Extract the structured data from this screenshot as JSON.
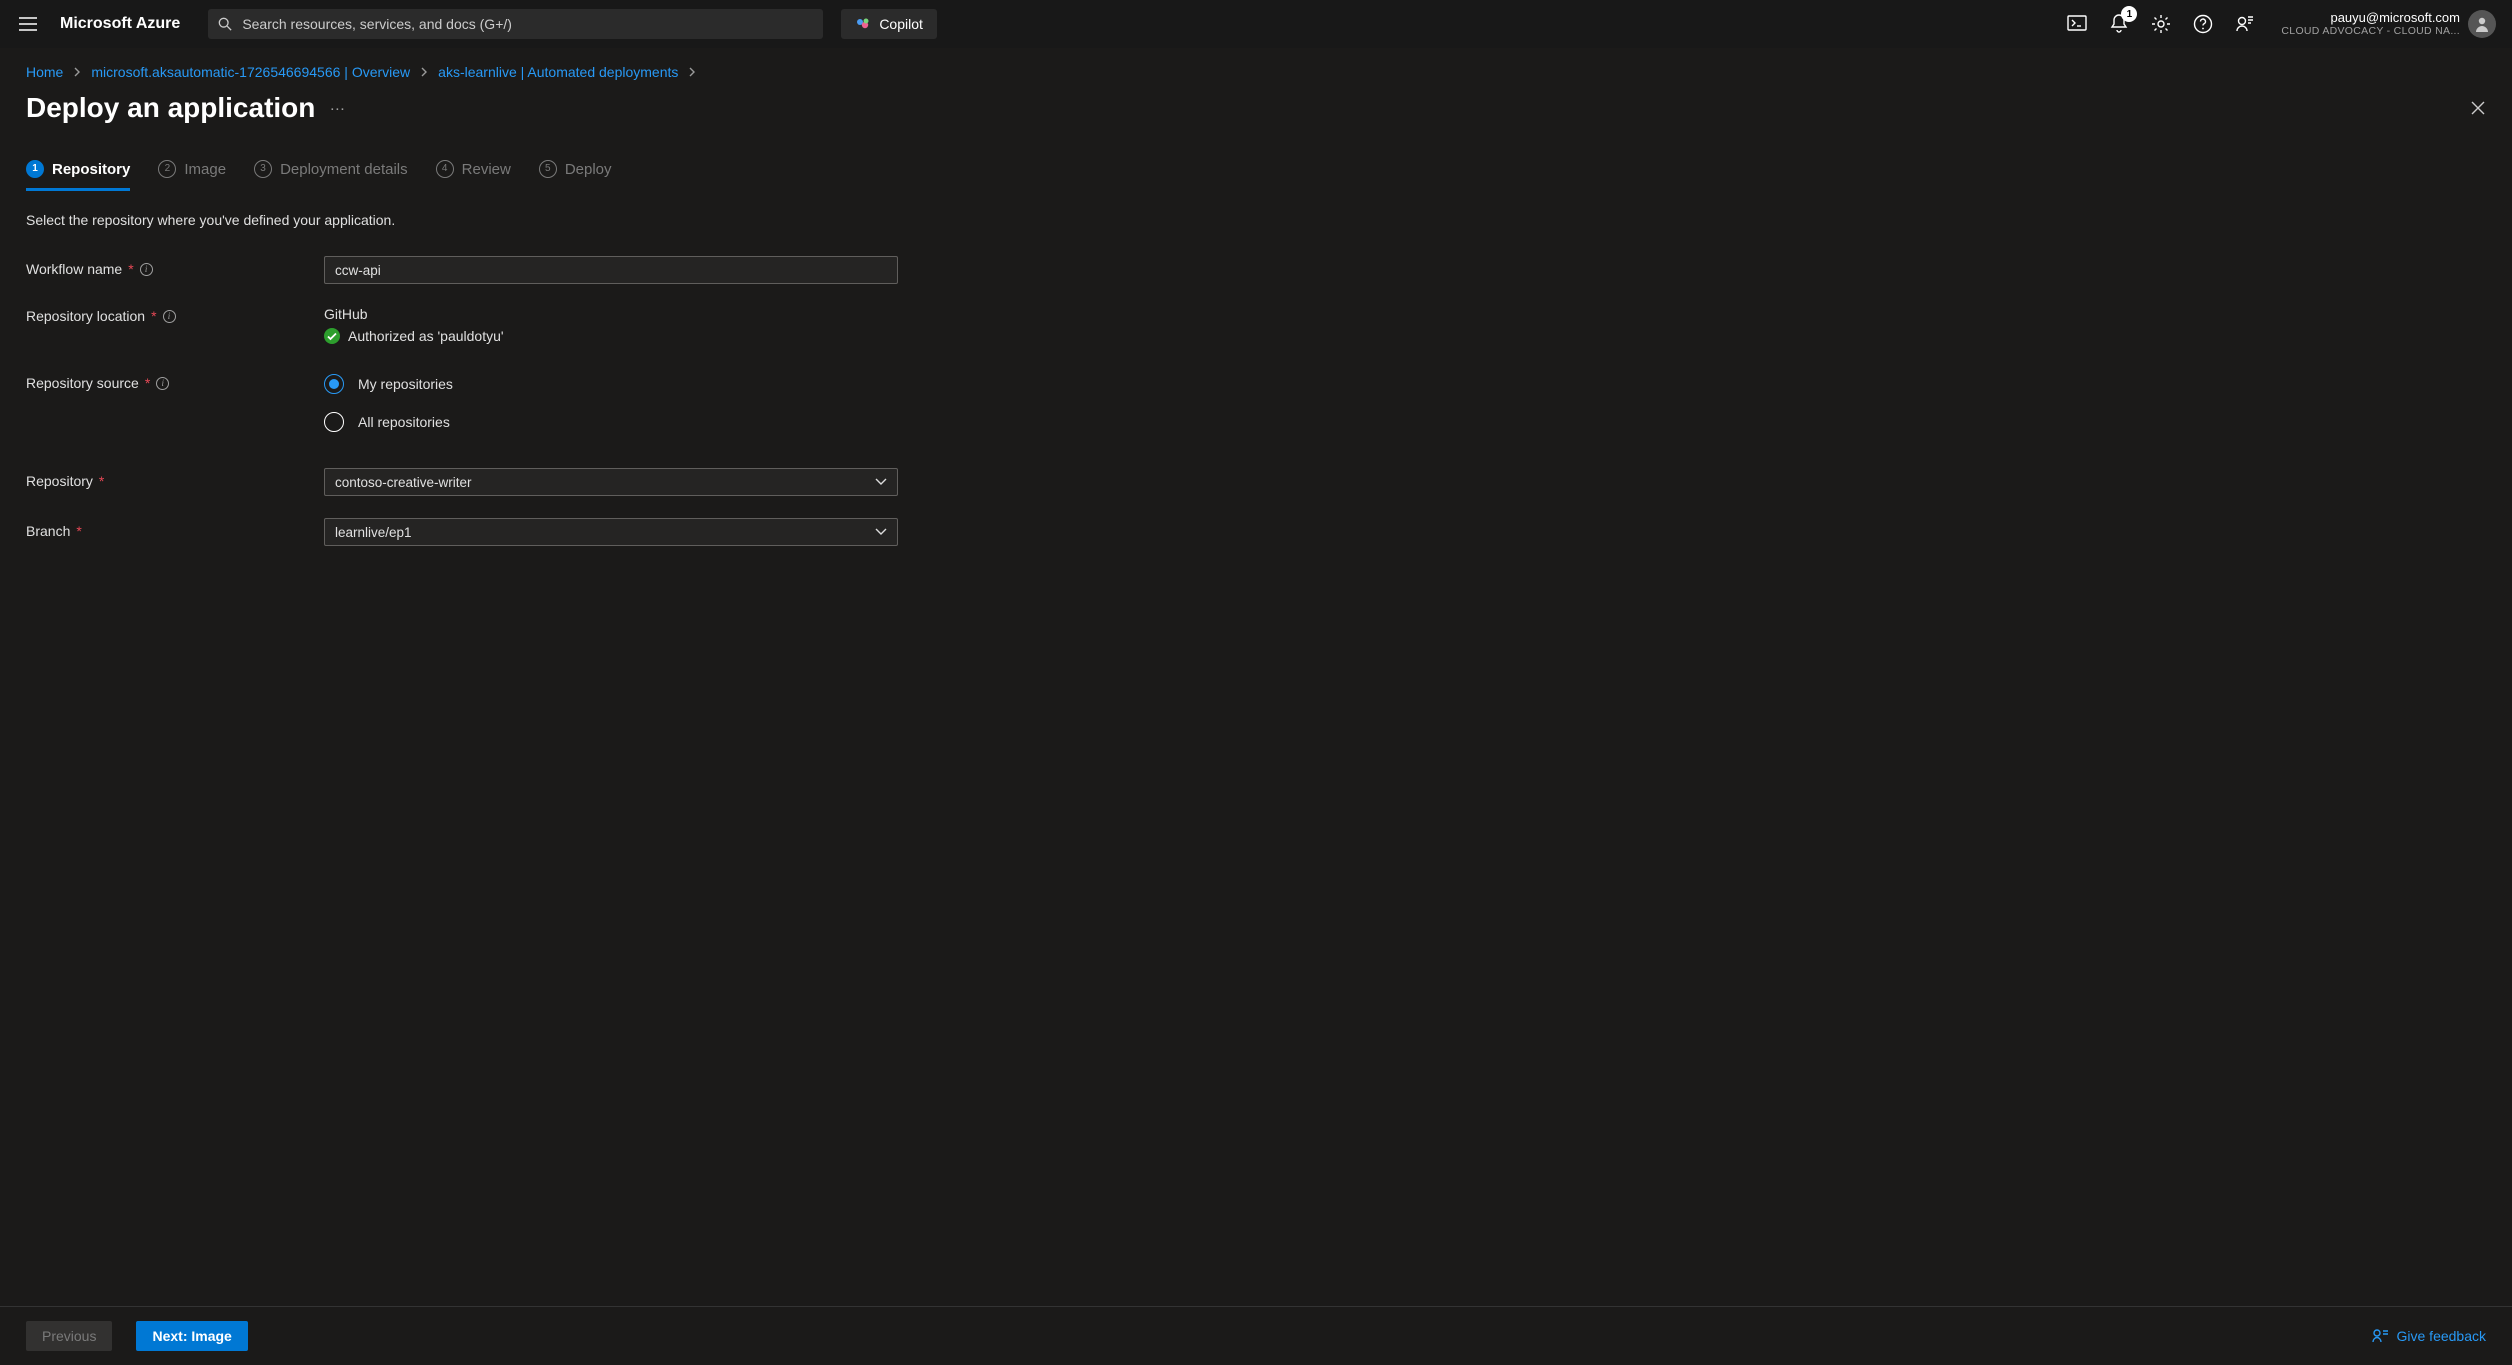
{
  "topbar": {
    "brand": "Microsoft Azure",
    "search_placeholder": "Search resources, services, and docs (G+/)",
    "copilot_label": "Copilot",
    "notification_count": "1",
    "account": {
      "email": "pauyu@microsoft.com",
      "tenant": "CLOUD ADVOCACY - CLOUD NA..."
    }
  },
  "breadcrumbs": {
    "items": [
      {
        "label": "Home"
      },
      {
        "label": "microsoft.aksautomatic-1726546694566 | Overview"
      },
      {
        "label": "aks-learnlive | Automated deployments"
      }
    ]
  },
  "page": {
    "title": "Deploy an application"
  },
  "steps": [
    {
      "n": "1",
      "label": "Repository",
      "active": true
    },
    {
      "n": "2",
      "label": "Image",
      "active": false
    },
    {
      "n": "3",
      "label": "Deployment details",
      "active": false
    },
    {
      "n": "4",
      "label": "Review",
      "active": false
    },
    {
      "n": "5",
      "label": "Deploy",
      "active": false
    }
  ],
  "content": {
    "description": "Select the repository where you've defined your application."
  },
  "form": {
    "workflow_name": {
      "label": "Workflow name",
      "value": "ccw-api"
    },
    "repo_location": {
      "label": "Repository location",
      "provider": "GitHub",
      "auth_text": "Authorized as 'pauldotyu'"
    },
    "repo_source": {
      "label": "Repository source",
      "option1": "My repositories",
      "option2": "All repositories"
    },
    "repository": {
      "label": "Repository",
      "value": "contoso-creative-writer"
    },
    "branch": {
      "label": "Branch",
      "value": "learnlive/ep1"
    }
  },
  "footer": {
    "prev": "Previous",
    "next": "Next: Image",
    "feedback": "Give feedback"
  }
}
